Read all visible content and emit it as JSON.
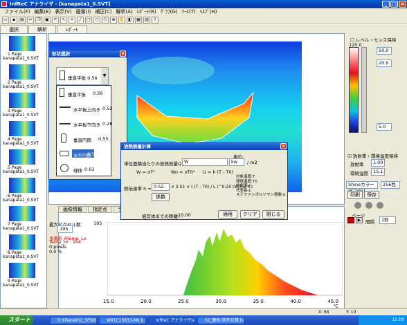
{
  "window": {
    "title": "InfReC アナライザ - [kanapata1_0.SVT]"
  },
  "menu": [
    "ファイル(F)",
    "編集(E)",
    "表示(V)",
    "画像(I)",
    "補正(C)",
    "解析(A)",
    "ﾚﾎﾟｰﾄ(R)",
    "ｸﾞﾗﾌ(G)",
    "ﾂｰﾙ(T)",
    "ﾍﾙﾌﾟ(H)"
  ],
  "tabs": [
    "選択",
    "解析",
    "ﾚﾎﾟｰﾄ"
  ],
  "thumbs": [
    {
      "n": "1 Page",
      "f": "kanapata1_0.SVT"
    },
    {
      "n": "2 Page",
      "f": "kanapata1_0.SVT"
    },
    {
      "n": "3 Page",
      "f": "kanapata1_0.SVT"
    },
    {
      "n": "4 Page",
      "f": "kanapata1_0.SVT"
    },
    {
      "n": "5 Page",
      "f": "kanapata1_0.SVT"
    },
    {
      "n": "6 Page",
      "f": "kanapata1_0.SVT"
    },
    {
      "n": "7 Page",
      "f": "kanapata1_0.SVT"
    },
    {
      "n": "8 Page",
      "f": "kanapata1_0.SVT"
    },
    {
      "n": "9 Page",
      "f": "kanapata1_0.SVT"
    }
  ],
  "shape_dialog": {
    "title": "形状選択",
    "selected": "垂直平板  0.56",
    "items": [
      {
        "label": "垂直平板",
        "value": "0.56"
      },
      {
        "label": "水平板上向き",
        "value": "0.52"
      },
      {
        "label": "水平板下向き",
        "value": "0.26"
      },
      {
        "label": "垂直円筒",
        "value": "0.55"
      },
      {
        "label": "水平円筒",
        "value": "0.52"
      },
      {
        "label": "球体",
        "value": "0.63"
      }
    ]
  },
  "heat_dialog": {
    "title": "放熱熱量計算",
    "unit_label": "単位:",
    "line1_label": "単位面積当たりの放熱熱量Q =",
    "q_unit": "W",
    "area_unit": "kw",
    "area_suffix": "/ m2",
    "eq_w": "W = σT⁴",
    "eq_wo": "Wo = σT0⁴",
    "eq_u": "U = h (T - T0)",
    "h_label": "熱伝達率 h =",
    "h_value": "0.52",
    "h_formula": "× 2.51 × ( (T - T0) / L )^0.25   (W/m2℃)",
    "calc_btn": "係数",
    "legend": [
      "対象温度:T",
      "環境温度:T0",
      "放射率:ε",
      "代表長:L",
      "ステファンボルツマン係数:σ"
    ],
    "dist_label": "被写体までの距離:",
    "dist_value": "10.00",
    "apply": "適用",
    "clear": "クリア",
    "close": "閉じる"
  },
  "graph": {
    "tabs": [
      "画像情報",
      "指定点",
      "ライン"
    ],
    "max_label": "最大ピクセル数",
    "max_value": "195",
    "ymax": "195",
    "region": "多角形 ATemp_Lo",
    "region2": "Temp_Hi : 264",
    "pixels": "0 pixels",
    "percent": "0.0 %",
    "xticks": [
      "15.0",
      "20.0",
      "25.0",
      "30.0",
      "35.0",
      "40.0",
      "45.0"
    ],
    "xunit": "℃"
  },
  "right": {
    "chk_level": "レベル・センス保持",
    "scale_top": "120.0",
    "v1": "50.0",
    "v2": "20.0",
    "v3": "5.0",
    "chk_emiss": "放射率・環境温度保持",
    "emiss_label": "放射率",
    "emiss_value": "1.00",
    "env_label": "環境温度",
    "env_value": "15.1",
    "palette": "Shineカラー(ﾃﾞﾌｫﾙﾄ)",
    "levels": "256色",
    "btn_a": "印刷",
    "btn_b": "保存",
    "page_label": "ページ",
    "interval_label": "間隔",
    "interval_value": "1秒"
  },
  "status": {
    "x": "X: 65",
    "y": "Y: 10"
  },
  "taskbar": {
    "start": "スタート",
    "tasks": [
      "D:¥Data¥02_SFSKEN...",
      "W¥1C15615-Mk.b.MO...",
      "InfReC アナライザ(a...",
      "02_解析(赤外計算.bm..."
    ],
    "clock": "15:00"
  },
  "colors": {
    "accent": "#0842b0",
    "thermal_hot": "#e02020",
    "thermal_cold": "#1a2fd0"
  }
}
